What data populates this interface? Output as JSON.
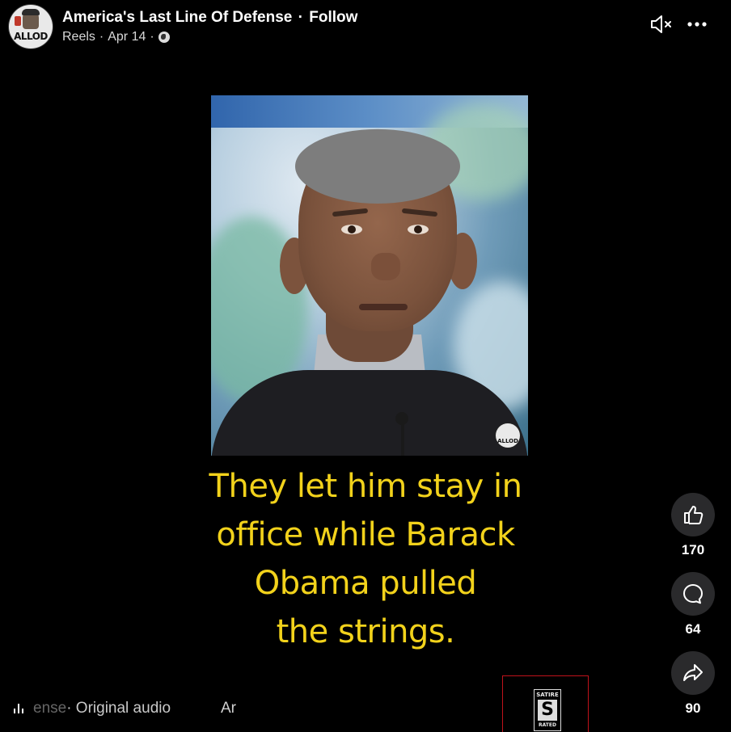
{
  "header": {
    "avatar_text": "ALLOD",
    "page_name": "America's Last Line Of Defense",
    "separator": "·",
    "follow_label": "Follow",
    "sub": {
      "section": "Reels",
      "date": "Apr 14",
      "dot": "·",
      "privacy_icon": "globe-icon"
    },
    "icons": [
      "speaker-muted-icon",
      "more-horizontal-icon"
    ]
  },
  "video": {
    "watermark_text": "ALLOD"
  },
  "caption": {
    "lines": [
      "They let him stay in",
      "office while Barack",
      "Obama pulled",
      "the strings."
    ],
    "color": "#f2d21b"
  },
  "actions": {
    "like": {
      "icon": "thumbs-up-icon",
      "count": "170"
    },
    "comment": {
      "icon": "comment-bubble-icon",
      "count": "64"
    },
    "share": {
      "icon": "share-arrow-icon",
      "count": "90"
    }
  },
  "audio": {
    "icon": "audio-wave-icon",
    "faded": "ense",
    "text": " · Original audio",
    "next": "Ar"
  },
  "satire_badge": {
    "top": "SATIRE",
    "letter": "S",
    "bottom": "RATED",
    "border_color": "#c0121b"
  }
}
